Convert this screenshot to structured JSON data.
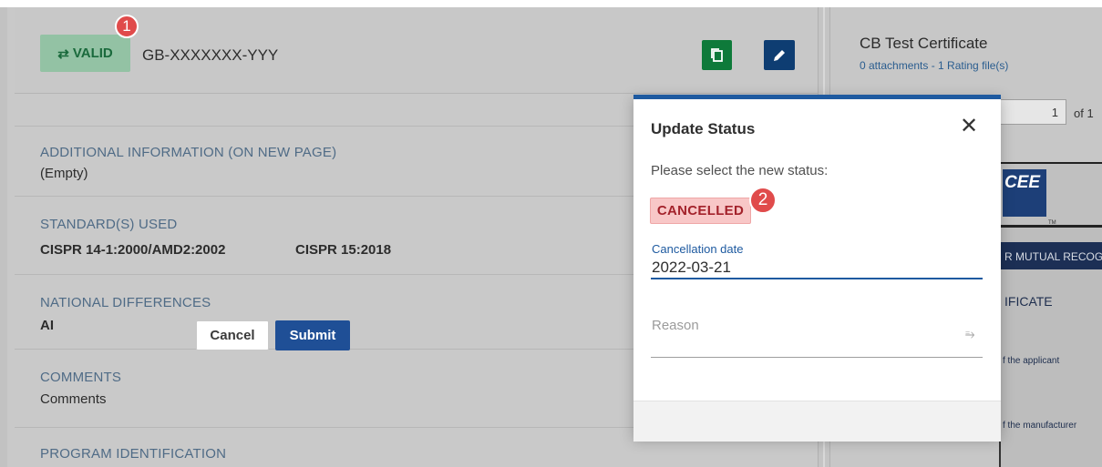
{
  "header": {
    "status_badge": "VALID",
    "certificate_number": "GB-XXXXXXX-YYY",
    "marker_1": "1"
  },
  "sections": {
    "additional_info": {
      "label": "ADDITIONAL INFORMATION (ON NEW PAGE)",
      "value": "(Empty)"
    },
    "standards": {
      "label": "STANDARD(S) USED",
      "values": [
        "CISPR 14-1:2000/AMD2:2002",
        "CISPR 15:2018"
      ]
    },
    "national_differences": {
      "label": "NATIONAL DIFFERENCES",
      "value": "AI"
    },
    "comments": {
      "label": "COMMENTS",
      "value": "Comments"
    },
    "program_identification": {
      "label": "PROGRAM IDENTIFICATION"
    }
  },
  "right_panel": {
    "title": "CB Test Certificate",
    "subtitle": "0 attachments - 1 Rating file(s)",
    "page_current": "1",
    "page_of": "of 1",
    "doc_logo_text": "CEE",
    "doc_tm": "TM",
    "doc_banner": "R MUTUAL RECOGN",
    "doc_certificate": "IFICATE",
    "doc_applicant": "f the applicant",
    "doc_manufacturer": "f the manufacturer"
  },
  "modal": {
    "title": "Update Status",
    "close_icon": "close-icon",
    "prompt": "Please select the new status:",
    "new_status": "CANCELLED",
    "marker_2": "2",
    "cancellation_date_label": "Cancellation date",
    "cancellation_date_value": "2022-03-21",
    "reason_placeholder": "Reason",
    "cancel_label": "Cancel",
    "submit_label": "Submit"
  },
  "colors": {
    "valid_green": "#93c2a4",
    "cancelled_red": "#f8c7c7",
    "primary_blue": "#1e5aa0",
    "copy_green": "#0e7a3a",
    "marker_red": "#e04b4b"
  }
}
